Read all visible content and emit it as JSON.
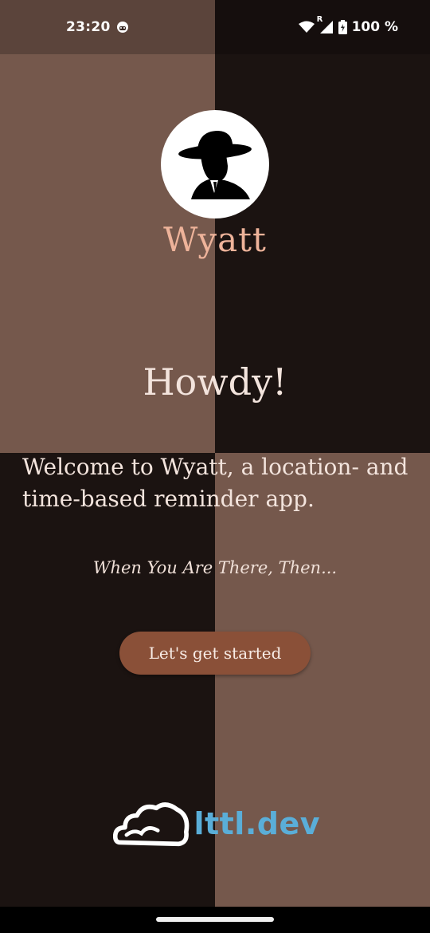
{
  "status_bar": {
    "time": "23:20",
    "battery": "100 %",
    "icons": [
      "face-icon",
      "wifi-icon",
      "signal-icon",
      "battery-icon"
    ],
    "roaming_letter": "R"
  },
  "app": {
    "name": "Wyatt",
    "greeting": "Howdy!",
    "welcome": "Welcome to Wyatt, a location- and time-based reminder app.",
    "tagline": "When You Are There, Then...",
    "start_button": "Let's get started"
  },
  "brand": {
    "text": "lttl.dev",
    "icon": "cloud-icon"
  },
  "colors": {
    "dark": "#1b1311",
    "light": "#75584c",
    "accent_title": "#eeb39a",
    "button": "#8a5038",
    "brand": "#5aaed8"
  }
}
